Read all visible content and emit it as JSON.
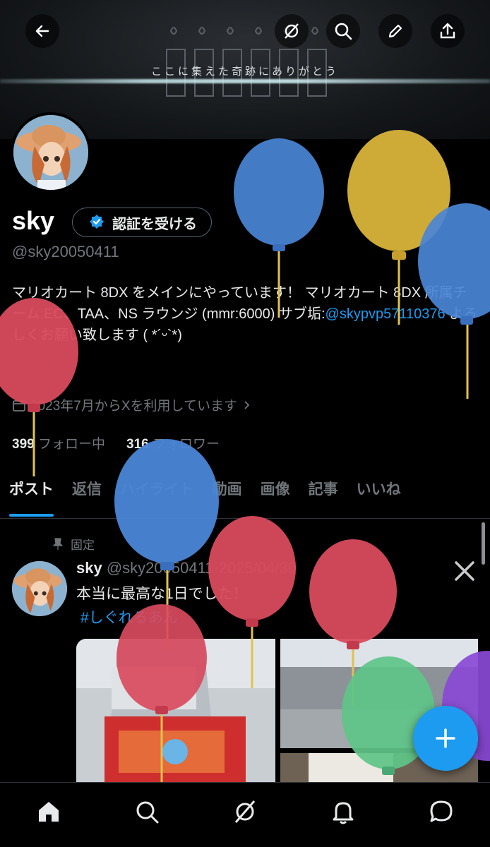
{
  "banner": {
    "text": "ここに集えた奇跡にありがとう"
  },
  "header_buttons": {
    "back": "arrow-left-icon",
    "grok": "grok-icon",
    "search": "search-icon",
    "edit": "pencil-icon",
    "share": "share-icon"
  },
  "profile": {
    "name": "sky",
    "verify_label": "認証を受ける",
    "handle": "@sky20050411",
    "bio_part1": "マリオカート 8DX をメインにやっています！ マリオカート 8DX 所属チーム:EC、TAA、NS ラウンジ (mmr:6000) サブ垢:",
    "bio_link": "@skypvp57110376",
    "bio_part2": " よろしくお願い致します ( *´ᵕ`*)",
    "joined": "2023年7月からXを利用しています",
    "following_count": "399",
    "following_label": "フォロー中",
    "followers_count": "316",
    "followers_label": "フォロワー"
  },
  "tabs": [
    {
      "label": "ポスト"
    },
    {
      "label": "返信"
    },
    {
      "label": "ハイライト"
    },
    {
      "label": "動画"
    },
    {
      "label": "画像"
    },
    {
      "label": "記事"
    },
    {
      "label": "いいね"
    }
  ],
  "post": {
    "pinned_label": "固定",
    "author": "sky",
    "handle_date": "@sky20050411·2025/04/30",
    "text": "本当に最高な1日でした！",
    "hashtag": "#しぐれるあん"
  },
  "bottom_nav": [
    "home-icon",
    "search-icon",
    "grok-icon",
    "bell-icon",
    "chat-icon"
  ],
  "colors": {
    "accent": "#1d9bf0",
    "background": "#000000",
    "muted": "#71767b"
  }
}
